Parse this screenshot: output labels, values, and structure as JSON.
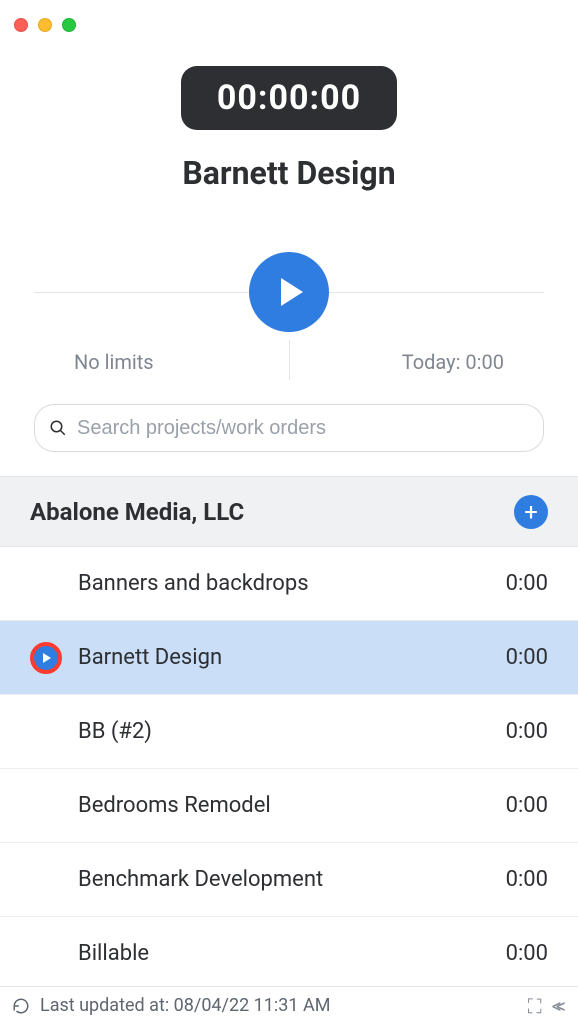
{
  "timer": {
    "elapsed": "00:00:00"
  },
  "current_project": "Barnett Design",
  "limits_label": "No limits",
  "today_label": "Today: 0:00",
  "search": {
    "placeholder": "Search projects/work orders"
  },
  "group": {
    "name": "Abalone Media, LLC",
    "add_label": "+"
  },
  "rows": [
    {
      "name": "Banners and backdrops",
      "time": "0:00",
      "selected": false,
      "showPlay": false
    },
    {
      "name": "Barnett Design",
      "time": "0:00",
      "selected": true,
      "showPlay": true
    },
    {
      "name": "BB (#2)",
      "time": "0:00",
      "selected": false,
      "showPlay": false
    },
    {
      "name": "Bedrooms Remodel",
      "time": "0:00",
      "selected": false,
      "showPlay": false
    },
    {
      "name": "Benchmark Development",
      "time": "0:00",
      "selected": false,
      "showPlay": false
    },
    {
      "name": "Billable",
      "time": "0:00",
      "selected": false,
      "showPlay": false
    }
  ],
  "status": {
    "last_updated": "Last updated at: 08/04/22 11:31 AM"
  }
}
